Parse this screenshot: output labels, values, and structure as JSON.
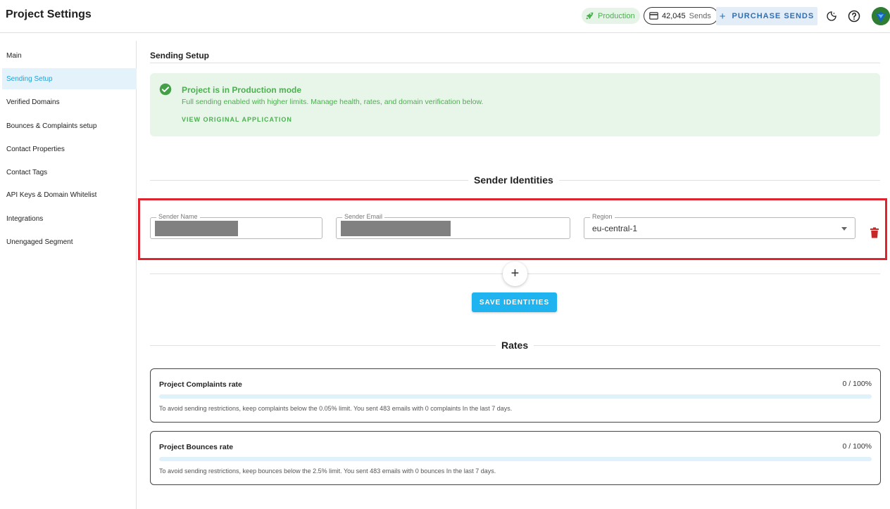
{
  "header": {
    "title": "Project Settings",
    "production_label": "Production",
    "sends_count": "42,045",
    "sends_unit": "Sends",
    "purchase_label": "PURCHASE SENDS",
    "icons": [
      "rocket-icon",
      "credit-card-icon",
      "plus-icon",
      "dark-mode-icon",
      "help-icon",
      "avatar"
    ]
  },
  "sidebar": {
    "items": [
      {
        "label": "Main",
        "active": false
      },
      {
        "label": "Sending Setup",
        "active": true
      },
      {
        "label": "Verified Domains",
        "active": false
      },
      {
        "label": "Bounces & Complaints setup",
        "active": false
      },
      {
        "label": "Contact Properties",
        "active": false
      },
      {
        "label": "Contact Tags",
        "active": false
      },
      {
        "label": "API Keys & Domain Whitelist",
        "active": false
      },
      {
        "label": "Integrations",
        "active": false
      },
      {
        "label": "Unengaged Segment",
        "active": false
      }
    ]
  },
  "main": {
    "section_title": "Sending Setup",
    "alert": {
      "title": "Project is in Production mode",
      "description": "Full sending enabled with higher limits. Manage health, rates, and domain verification below.",
      "link": "VIEW ORIGINAL APPLICATION"
    },
    "sender_identities": {
      "heading": "Sender Identities",
      "sender_name_label": "Sender Name",
      "sender_email_label": "Sender Email",
      "region_label": "Region",
      "region_value": "eu-central-1",
      "add_symbol": "+",
      "save_label": "SAVE IDENTITIES"
    },
    "rates": {
      "heading": "Rates",
      "cards": [
        {
          "title": "Project Complaints rate",
          "value": "0 / 100%",
          "progress_fraction": 0,
          "note": "To avoid sending restrictions, keep complaints below the 0.05% limit. You sent 483 emails with 0 complaints In the last 7 days."
        },
        {
          "title": "Project Bounces rate",
          "value": "0 / 100%",
          "progress_fraction": 0,
          "note": "To avoid sending restrictions, keep bounces below the 2.5% limit. You sent 483 emails with 0 bounces In the last 7 days."
        }
      ]
    }
  },
  "colors": {
    "accent": "#1fb3f0",
    "success": "#4caf50",
    "highlight": "#e0242f",
    "danger": "#c62828"
  }
}
